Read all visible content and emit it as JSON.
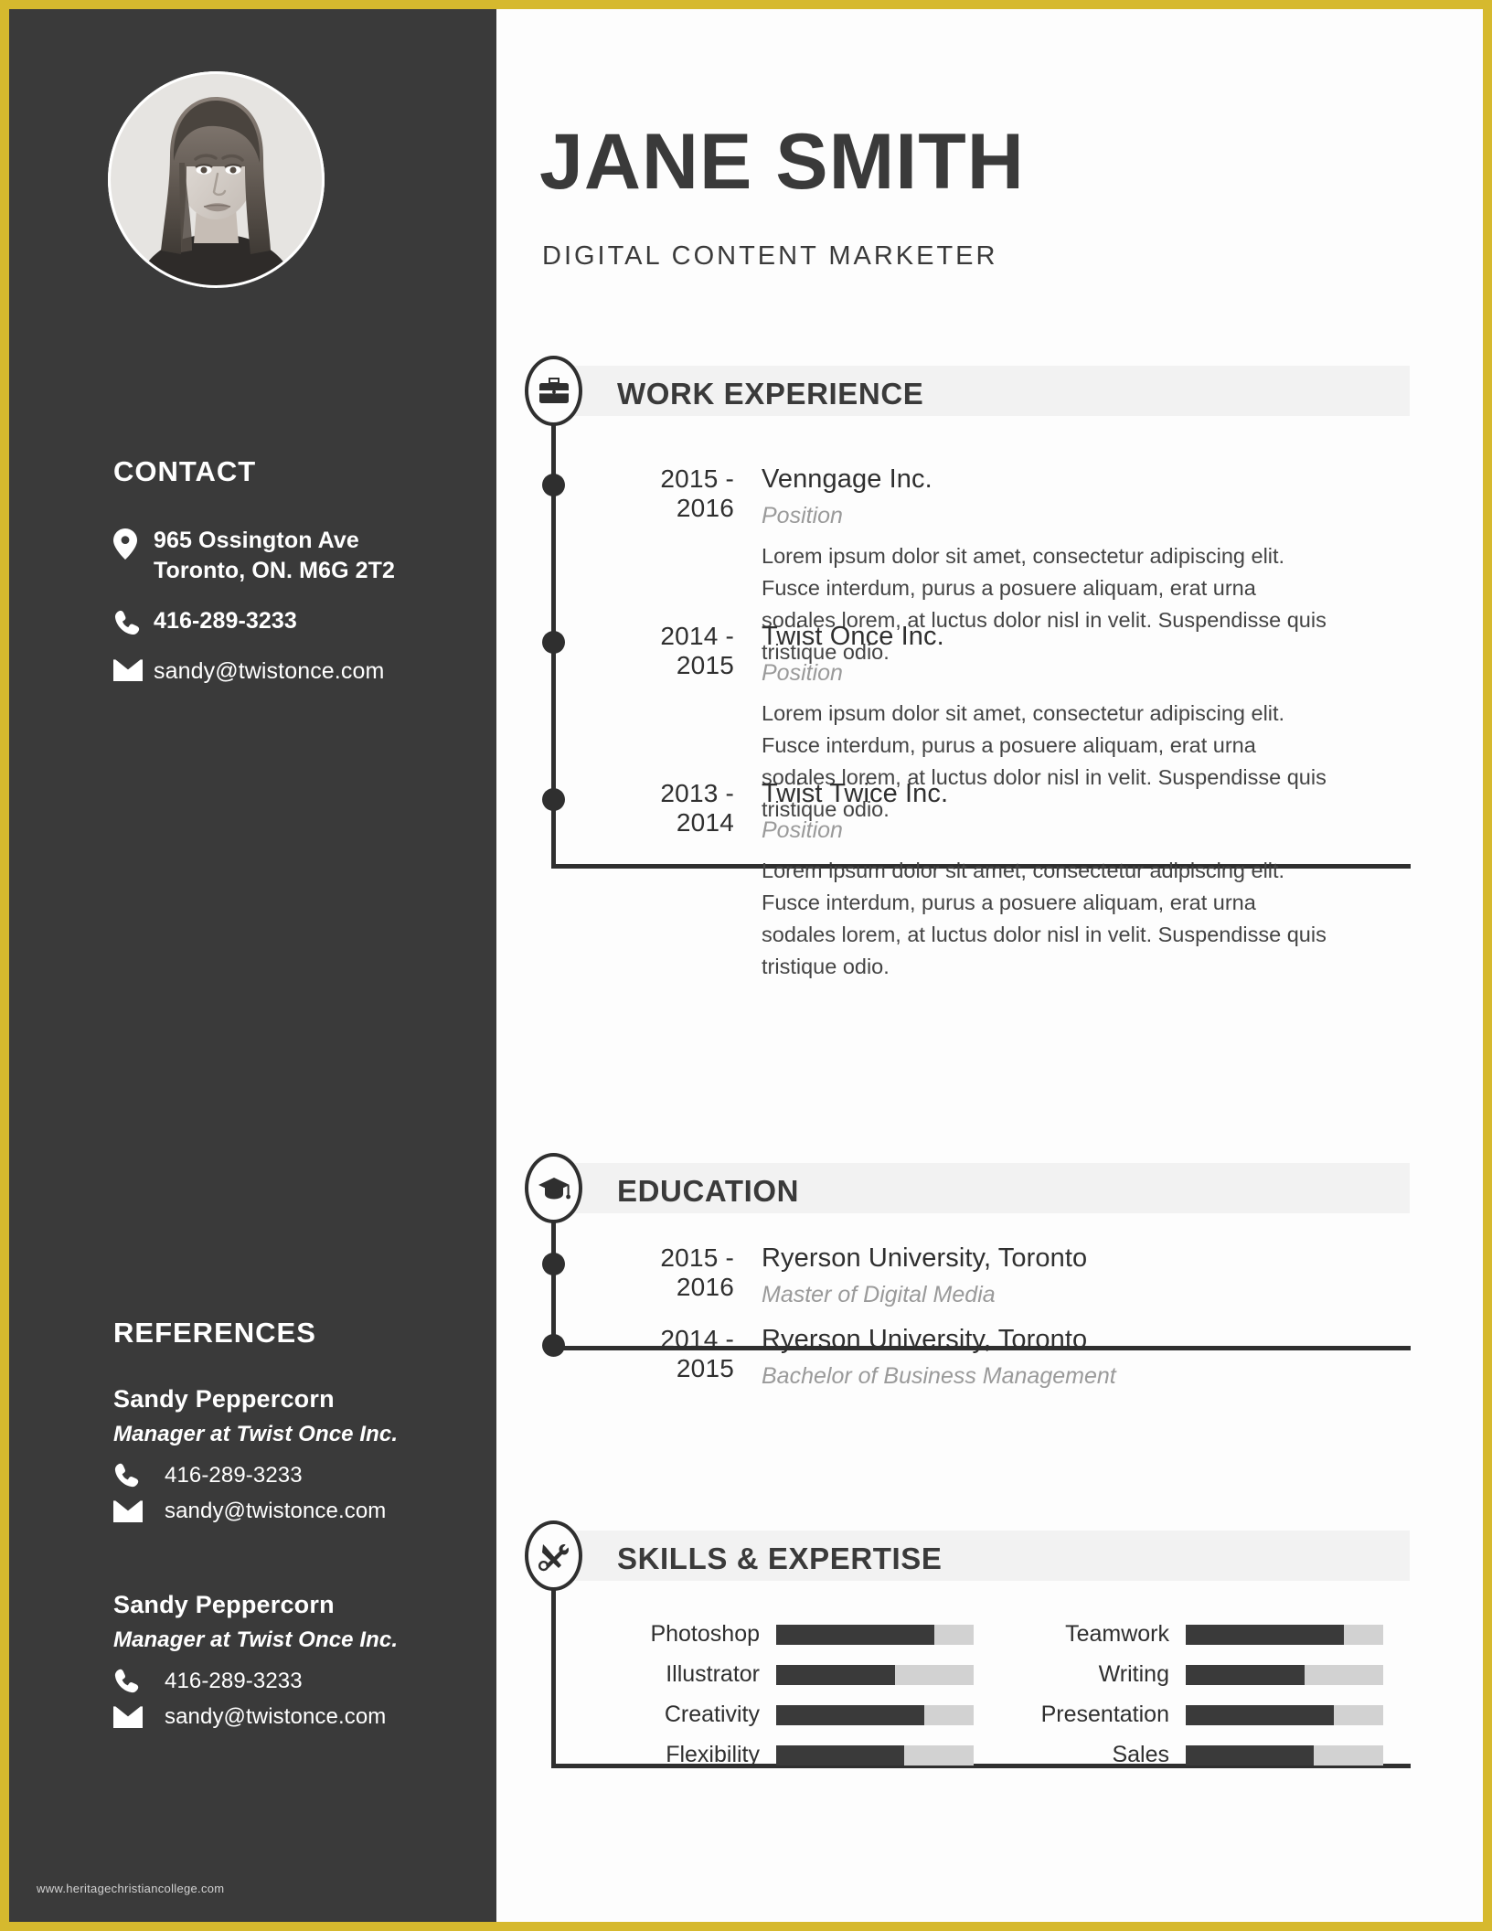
{
  "theme": {
    "border_color": "#d6b92e",
    "sidebar_bg": "#3a3a3a",
    "accent_dark": "#3a3a3a",
    "section_bar_bg": "#f2f2f2",
    "bar_track": "#d2d2d2",
    "muted_text": "#9a9a9a"
  },
  "header": {
    "name": "JANE SMITH",
    "subtitle": "DIGITAL CONTENT MARKETER"
  },
  "sidebar": {
    "contact": {
      "heading": "CONTACT",
      "items": [
        {
          "icon": "location-pin-icon",
          "lines": [
            "965 Ossington Ave",
            "Toronto, ON. M6G 2T2"
          ]
        },
        {
          "icon": "phone-icon",
          "lines": [
            "416-289-3233"
          ]
        },
        {
          "icon": "envelope-icon",
          "lines": [
            "sandy@twistonce.com"
          ]
        }
      ]
    },
    "references": {
      "heading": "REFERENCES",
      "items": [
        {
          "name": "Sandy Peppercorn",
          "role": "Manager at Twist Once Inc.",
          "phone": "416-289-3233",
          "email": "sandy@twistonce.com"
        },
        {
          "name": "Sandy Peppercorn",
          "role": "Manager at Twist Once Inc.",
          "phone": "416-289-3233",
          "email": "sandy@twistonce.com"
        }
      ]
    },
    "watermark": "www.heritagechristiancollege.com"
  },
  "sections": {
    "work": {
      "title": "WORK EXPERIENCE",
      "icon": "briefcase-icon",
      "entries": [
        {
          "years": "2015 - 2016",
          "organization": "Venngage Inc.",
          "position": "Position",
          "description": "Lorem ipsum dolor sit amet, consectetur adipiscing elit. Fusce interdum, purus a posuere aliquam, erat urna sodales lorem, at luctus dolor nisl in velit. Suspendisse quis tristique odio."
        },
        {
          "years": "2014 - 2015",
          "organization": "Twist Once Inc.",
          "position": "Position",
          "description": "Lorem ipsum dolor sit amet, consectetur adipiscing elit. Fusce interdum, purus a posuere aliquam, erat urna sodales lorem, at luctus dolor nisl in velit. Suspendisse quis tristique odio."
        },
        {
          "years": "2013 - 2014",
          "organization": "Twist Twice Inc.",
          "position": "Position",
          "description": "Lorem ipsum dolor sit amet, consectetur adipiscing elit. Fusce interdum, purus a posuere aliquam, erat urna sodales lorem, at luctus dolor nisl in velit. Suspendisse quis tristique odio."
        }
      ]
    },
    "education": {
      "title": "EDUCATION",
      "icon": "graduation-cap-icon",
      "entries": [
        {
          "years": "2015 - 2016",
          "organization": "Ryerson University, Toronto",
          "position": "Master of Digital Media"
        },
        {
          "years": "2014 - 2015",
          "organization": "Ryerson University, Toronto",
          "position": "Bachelor of Business Management"
        }
      ]
    },
    "skills": {
      "title": "SKILLS & EXPERTISE",
      "icon": "tools-icon",
      "left_column": [
        {
          "label": "Photoshop",
          "value": 80
        },
        {
          "label": "Illustrator",
          "value": 60
        },
        {
          "label": "Creativity",
          "value": 75
        },
        {
          "label": "Flexibility",
          "value": 65
        }
      ],
      "right_column": [
        {
          "label": "Teamwork",
          "value": 80
        },
        {
          "label": "Writing",
          "value": 60
        },
        {
          "label": "Presentation",
          "value": 75
        },
        {
          "label": "Sales",
          "value": 65
        }
      ]
    }
  }
}
